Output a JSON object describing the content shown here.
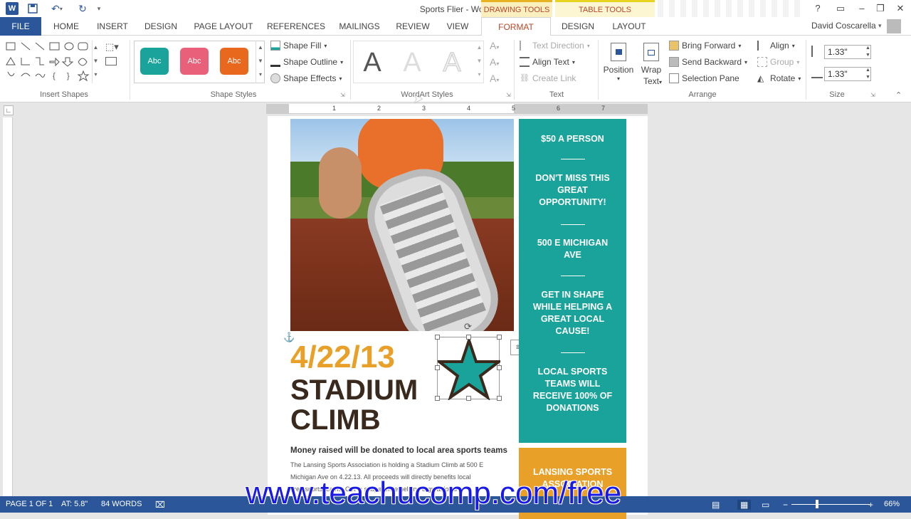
{
  "titlebar": {
    "title": "Sports Flier - Word",
    "drawing_tools": "DRAWING TOOLS",
    "table_tools": "TABLE TOOLS",
    "help": "?",
    "user": "David Coscarella"
  },
  "tabs": {
    "file": "FILE",
    "home": "HOME",
    "insert": "INSERT",
    "design": "DESIGN",
    "page_layout": "PAGE LAYOUT",
    "references": "REFERENCES",
    "mailings": "MAILINGS",
    "review": "REVIEW",
    "view": "VIEW",
    "format": "FORMAT",
    "table_design": "DESIGN",
    "layout": "LAYOUT"
  },
  "ribbon": {
    "insert_shapes_label": "Insert Shapes",
    "shape_styles_label": "Shape Styles",
    "shape_style_sample": "Abc",
    "shape_fill": "Shape Fill",
    "shape_outline": "Shape Outline",
    "shape_effects": "Shape Effects",
    "wordart_label": "WordArt Styles",
    "wordart_sample": "A",
    "text_direction": "Text Direction",
    "align_text": "Align Text",
    "create_link": "Create Link",
    "text_label": "Text",
    "position": "Position",
    "wrap_text_line1": "Wrap",
    "wrap_text_line2": "Text",
    "bring_forward": "Bring Forward",
    "send_backward": "Send Backward",
    "selection_pane": "Selection Pane",
    "align": "Align",
    "group": "Group",
    "rotate": "Rotate",
    "arrange_label": "Arrange",
    "height_value": "1.33\"",
    "width_value": "1.33\"",
    "size_label": "Size"
  },
  "ruler": {
    "ticks": [
      "1",
      "2",
      "3",
      "4",
      "5",
      "6",
      "7"
    ]
  },
  "document": {
    "date": "4/22/13",
    "title_line1": "STADIUM",
    "title_line2": "CLIMB",
    "subheading": "Money raised will be donated to local area sports teams",
    "body_line1": "The Lansing Sports Association is holding a Stadium Climb at 500 E",
    "body_line2": "Michigan Ave on 4.22.13. All proceeds will directly benefits local",
    "body_line3": "area sports teams. Get in shape while helping a great local",
    "sidebar": {
      "item1": "$50 A PERSON",
      "item2": "DON'T MISS THIS GREAT OPPORTUNITY!",
      "item3": "500 E MICHIGAN AVE",
      "item4": "GET IN SHAPE WHILE HELPING A GREAT LOCAL CAUSE!",
      "item5": "LOCAL SPORTS TEAMS WILL RECEIVE 100% OF DONATIONS"
    },
    "orange_box": "LANSING SPORTS ASSOCIATION",
    "colors": {
      "teal": "#1aa39a",
      "orange": "#e8a028",
      "date_color": "#e8a028",
      "title_color": "#3a2a1e"
    }
  },
  "statusbar": {
    "page": "PAGE 1 OF 1",
    "at": "AT: 5.8\"",
    "words": "84 WORDS",
    "zoom": "66%"
  },
  "watermark": "www.teachucomp.com/free"
}
